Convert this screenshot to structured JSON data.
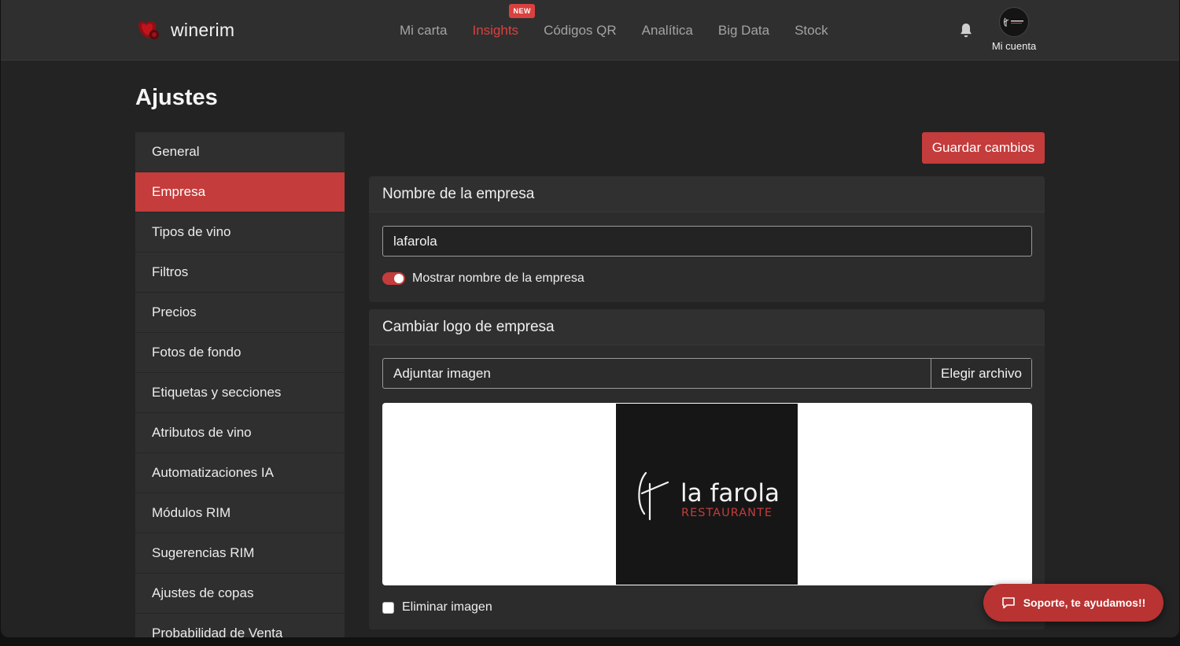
{
  "header": {
    "brand_name": "winerim",
    "nav": [
      {
        "label": "Mi carta",
        "active": false
      },
      {
        "label": "Insights",
        "active": true,
        "badge": "NEW"
      },
      {
        "label": "Códigos QR",
        "active": false
      },
      {
        "label": "Analítica",
        "active": false
      },
      {
        "label": "Big Data",
        "active": false
      },
      {
        "label": "Stock",
        "active": false
      }
    ],
    "account_label": "Mi cuenta"
  },
  "page_title": "Ajustes",
  "sidebar": {
    "items": [
      {
        "label": "General"
      },
      {
        "label": "Empresa",
        "active": true
      },
      {
        "label": "Tipos de vino"
      },
      {
        "label": "Filtros"
      },
      {
        "label": "Precios"
      },
      {
        "label": "Fotos de fondo"
      },
      {
        "label": "Etiquetas y secciones"
      },
      {
        "label": "Atributos de vino"
      },
      {
        "label": "Automatizaciones IA"
      },
      {
        "label": "Módulos RIM"
      },
      {
        "label": "Sugerencias RIM"
      },
      {
        "label": "Ajustes de copas"
      },
      {
        "label": "Probabilidad de Venta"
      }
    ]
  },
  "save_button": "Guardar cambios",
  "company_card": {
    "title": "Nombre de la empresa",
    "name_value": "lafarola",
    "toggle_label": "Mostrar nombre de la empresa",
    "toggle_on": true
  },
  "logo_card": {
    "title": "Cambiar logo de empresa",
    "file_placeholder": "Adjuntar imagen",
    "file_button": "Elegir archivo",
    "logo_text": "la farola",
    "logo_subtext": "RESTAURANTE",
    "remove_label": "Eliminar imagen",
    "remove_checked": false
  },
  "support_button": "Soporte, te ayudamos!!",
  "colors": {
    "accent": "#c43c3b",
    "background": "#232323",
    "topbar": "#2f2f2f"
  }
}
